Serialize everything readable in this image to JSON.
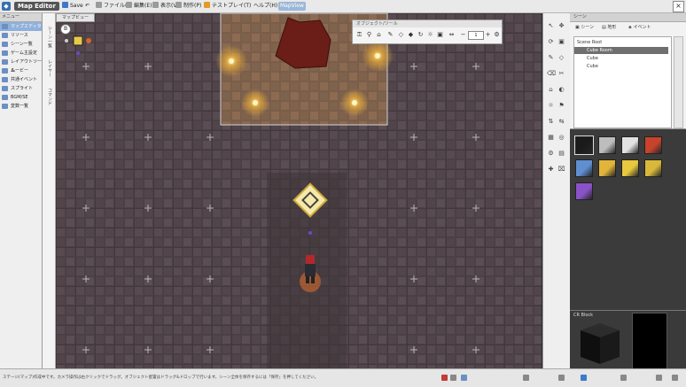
{
  "menubar": {
    "app_title": "Map Editor",
    "save": "Save",
    "items": [
      "ファイル(F)",
      "編集(E)",
      "表示(V)",
      "制作(P)"
    ],
    "playtest": "テストプレイ(T)",
    "help": "ヘルプ(H)",
    "mode": "MapView"
  },
  "left_panel": {
    "header": "メニュー",
    "items": [
      "マップエディタ",
      "リソース",
      "シーン一覧",
      "ゲーム主設定",
      "レイアウトツール",
      "ムービー",
      "共通イベント",
      "スプライト",
      "BGM/SE",
      "変数一覧"
    ],
    "selected_index": 0
  },
  "side_tabs": [
    "シーン一覧",
    "レイヤー",
    "コマンド"
  ],
  "main_view": {
    "tab": "マップビュー",
    "minimap_icon": "B"
  },
  "palette": {
    "title": "オブジェクト/ツール",
    "zoom_value": "1"
  },
  "scene_panel": {
    "header": "シーン",
    "tabs": [
      "シーン",
      "地形",
      "イベント"
    ],
    "tree": [
      "Scene Root",
      "Cube Room",
      "Cube",
      "Cube"
    ],
    "selected_index": 1
  },
  "blocks": {
    "colors": [
      "#1b1b1b",
      "#bdbdbd",
      "#e2e2e2",
      "#c8432b",
      "#5f8fd1",
      "#e0b53a",
      "#e7c83e",
      "#d9b93a",
      "#8a52c8"
    ]
  },
  "preview": {
    "label": "CR Block"
  },
  "status_bar": {
    "message": "ステージ(マップ)作成中です。カメラ操作は右クリックでドラッグ。オブジェクト配置はドラッグ&ドロップで行います。シーン全体を保存するには「保存」を押してください。"
  }
}
